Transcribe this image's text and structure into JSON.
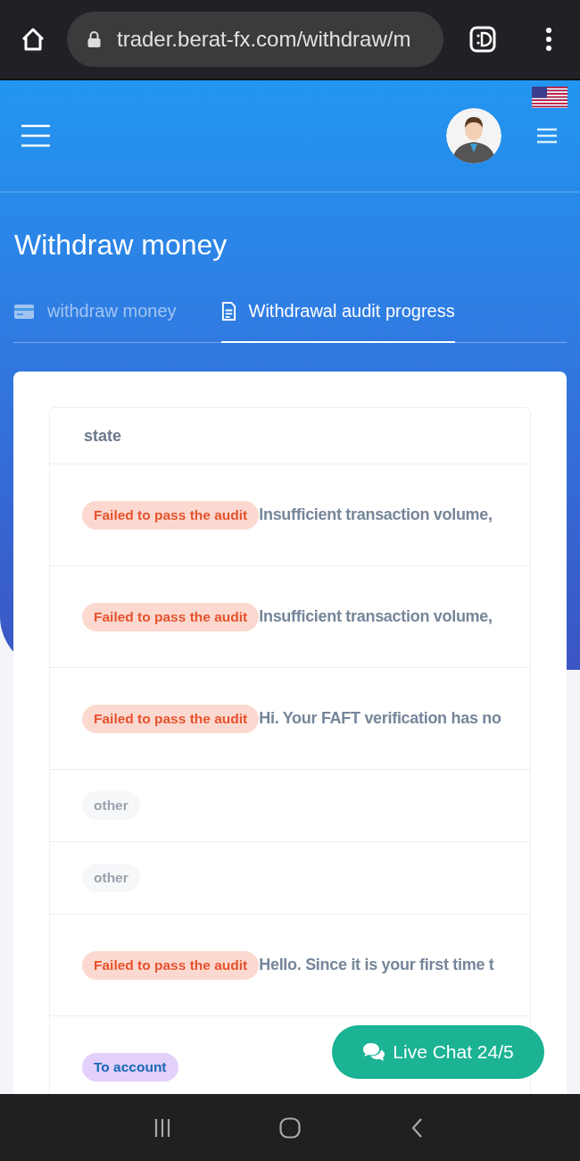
{
  "browser": {
    "url": "trader.berat-fx.com/withdraw/m"
  },
  "page": {
    "title": "Withdraw money"
  },
  "tabs": [
    {
      "label": "withdraw money",
      "selected": false,
      "kind": "card"
    },
    {
      "label": "Withdrawal audit progress",
      "selected": true,
      "kind": "document"
    }
  ],
  "table": {
    "columns": [
      "state"
    ],
    "rows": [
      {
        "status": "Failed to pass the audit",
        "kind": "failed",
        "note": "Insufficient transaction volume,"
      },
      {
        "status": "Failed to pass the audit",
        "kind": "failed",
        "note": "Insufficient transaction volume,"
      },
      {
        "status": "Failed to pass the audit",
        "kind": "failed",
        "note": "Hi. Your FAFT verification has no"
      },
      {
        "status": "other",
        "kind": "other"
      },
      {
        "status": "other",
        "kind": "other"
      },
      {
        "status": "Failed to pass the audit",
        "kind": "failed",
        "note": "Hello. Since it is your first time t"
      },
      {
        "status": "To account",
        "kind": "to_account"
      }
    ]
  },
  "chat": {
    "label": "Live Chat 24/5"
  }
}
